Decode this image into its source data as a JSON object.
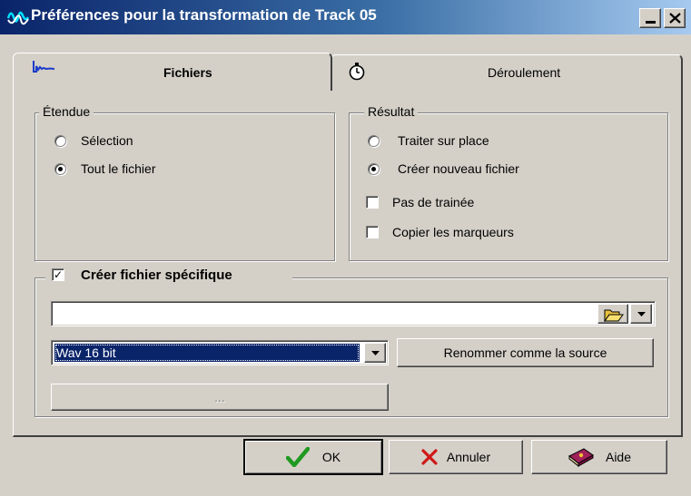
{
  "window": {
    "title": "Préférences pour la transformation de Track 05"
  },
  "tabs": [
    {
      "label": "Fichiers",
      "icon": "waveform-icon",
      "active": true
    },
    {
      "label": "Déroulement",
      "icon": "clock-icon",
      "active": false
    }
  ],
  "etendue": {
    "legend": "Étendue",
    "options": [
      {
        "label": "Sélection",
        "selected": false
      },
      {
        "label": "Tout le fichier",
        "selected": true
      }
    ]
  },
  "resultat": {
    "legend": "Résultat",
    "options": [
      {
        "label": "Traiter sur place",
        "selected": false
      },
      {
        "label": "Créer nouveau fichier",
        "selected": true
      }
    ],
    "checkboxes": [
      {
        "label": "Pas de trainée",
        "checked": false
      },
      {
        "label": "Copier les marqueurs",
        "checked": false
      }
    ]
  },
  "specific": {
    "legend": "Créer fichier spécifique",
    "checked": true,
    "path_value": "",
    "format_selected": "Wav 16 bit",
    "rename_label": "Renommer comme la source",
    "ellipsis_label": "..."
  },
  "footer": {
    "ok_label": "OK",
    "cancel_label": "Annuler",
    "help_label": "Aide"
  },
  "colors": {
    "face": "#d4d0c8",
    "title_start": "#0a246a",
    "title_end": "#a6caf0",
    "selection": "#0a246a"
  }
}
